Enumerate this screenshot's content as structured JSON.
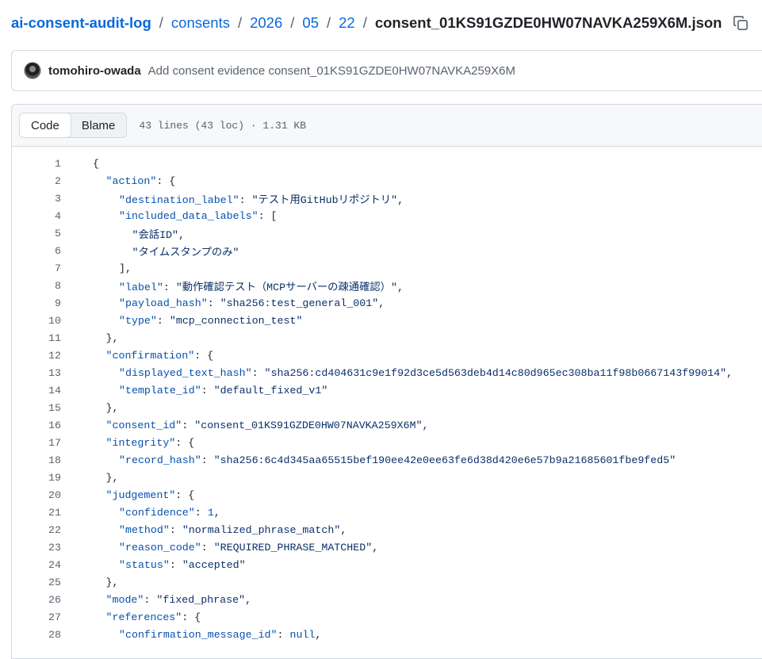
{
  "breadcrumb": {
    "repo": "ai-consent-audit-log",
    "parts": [
      "consents",
      "2026",
      "05",
      "22"
    ],
    "file": "consent_01KS91GZDE0HW07NAVKA259X6M.json",
    "separator": "/"
  },
  "commit": {
    "author": "tomohiro-owada",
    "message": "Add consent evidence consent_01KS91GZDE0HW07NAVKA259X6M"
  },
  "file_header": {
    "tabs": [
      "Code",
      "Blame"
    ],
    "active_tab": "Code",
    "meta": "43 lines (43 loc) · 1.31 KB"
  },
  "icons": {
    "copy": "copy-icon"
  },
  "colors": {
    "link": "#0969da",
    "key": "#0550ae",
    "string": "#0a3069"
  },
  "code_lines": [
    {
      "n": "1",
      "indent": 0,
      "parts": [
        [
          "p",
          "{"
        ]
      ]
    },
    {
      "n": "2",
      "indent": 1,
      "parts": [
        [
          "k",
          "\"action\""
        ],
        [
          "p",
          ": {"
        ]
      ]
    },
    {
      "n": "3",
      "indent": 2,
      "parts": [
        [
          "k",
          "\"destination_label\""
        ],
        [
          "p",
          ": "
        ],
        [
          "s",
          "\"テスト用GitHubリポジトリ\""
        ],
        [
          "p",
          ","
        ]
      ]
    },
    {
      "n": "4",
      "indent": 2,
      "parts": [
        [
          "k",
          "\"included_data_labels\""
        ],
        [
          "p",
          ": ["
        ]
      ]
    },
    {
      "n": "5",
      "indent": 3,
      "parts": [
        [
          "s",
          "\"会話ID\""
        ],
        [
          "p",
          ","
        ]
      ]
    },
    {
      "n": "6",
      "indent": 3,
      "parts": [
        [
          "s",
          "\"タイムスタンプのみ\""
        ]
      ]
    },
    {
      "n": "7",
      "indent": 2,
      "parts": [
        [
          "p",
          "],"
        ]
      ]
    },
    {
      "n": "8",
      "indent": 2,
      "parts": [
        [
          "k",
          "\"label\""
        ],
        [
          "p",
          ": "
        ],
        [
          "s",
          "\"動作確認テスト（MCPサーバーの疎通確認）\""
        ],
        [
          "p",
          ","
        ]
      ]
    },
    {
      "n": "9",
      "indent": 2,
      "parts": [
        [
          "k",
          "\"payload_hash\""
        ],
        [
          "p",
          ": "
        ],
        [
          "s",
          "\"sha256:test_general_001\""
        ],
        [
          "p",
          ","
        ]
      ]
    },
    {
      "n": "10",
      "indent": 2,
      "parts": [
        [
          "k",
          "\"type\""
        ],
        [
          "p",
          ": "
        ],
        [
          "s",
          "\"mcp_connection_test\""
        ]
      ]
    },
    {
      "n": "11",
      "indent": 1,
      "parts": [
        [
          "p",
          "},"
        ]
      ]
    },
    {
      "n": "12",
      "indent": 1,
      "parts": [
        [
          "k",
          "\"confirmation\""
        ],
        [
          "p",
          ": {"
        ]
      ]
    },
    {
      "n": "13",
      "indent": 2,
      "parts": [
        [
          "k",
          "\"displayed_text_hash\""
        ],
        [
          "p",
          ": "
        ],
        [
          "s",
          "\"sha256:cd404631c9e1f92d3ce5d563deb4d14c80d965ec308ba11f98b0667143f99014\""
        ],
        [
          "p",
          ","
        ]
      ]
    },
    {
      "n": "14",
      "indent": 2,
      "parts": [
        [
          "k",
          "\"template_id\""
        ],
        [
          "p",
          ": "
        ],
        [
          "s",
          "\"default_fixed_v1\""
        ]
      ]
    },
    {
      "n": "15",
      "indent": 1,
      "parts": [
        [
          "p",
          "},"
        ]
      ]
    },
    {
      "n": "16",
      "indent": 1,
      "parts": [
        [
          "k",
          "\"consent_id\""
        ],
        [
          "p",
          ": "
        ],
        [
          "s",
          "\"consent_01KS91GZDE0HW07NAVKA259X6M\""
        ],
        [
          "p",
          ","
        ]
      ]
    },
    {
      "n": "17",
      "indent": 1,
      "parts": [
        [
          "k",
          "\"integrity\""
        ],
        [
          "p",
          ": {"
        ]
      ]
    },
    {
      "n": "18",
      "indent": 2,
      "parts": [
        [
          "k",
          "\"record_hash\""
        ],
        [
          "p",
          ": "
        ],
        [
          "s",
          "\"sha256:6c4d345aa65515bef190ee42e0ee63fe6d38d420e6e57b9a21685601fbe9fed5\""
        ]
      ]
    },
    {
      "n": "19",
      "indent": 1,
      "parts": [
        [
          "p",
          "},"
        ]
      ]
    },
    {
      "n": "20",
      "indent": 1,
      "parts": [
        [
          "k",
          "\"judgement\""
        ],
        [
          "p",
          ": {"
        ]
      ]
    },
    {
      "n": "21",
      "indent": 2,
      "parts": [
        [
          "k",
          "\"confidence\""
        ],
        [
          "p",
          ": "
        ],
        [
          "n",
          "1"
        ],
        [
          "p",
          ","
        ]
      ]
    },
    {
      "n": "22",
      "indent": 2,
      "parts": [
        [
          "k",
          "\"method\""
        ],
        [
          "p",
          ": "
        ],
        [
          "s",
          "\"normalized_phrase_match\""
        ],
        [
          "p",
          ","
        ]
      ]
    },
    {
      "n": "23",
      "indent": 2,
      "parts": [
        [
          "k",
          "\"reason_code\""
        ],
        [
          "p",
          ": "
        ],
        [
          "s",
          "\"REQUIRED_PHRASE_MATCHED\""
        ],
        [
          "p",
          ","
        ]
      ]
    },
    {
      "n": "24",
      "indent": 2,
      "parts": [
        [
          "k",
          "\"status\""
        ],
        [
          "p",
          ": "
        ],
        [
          "s",
          "\"accepted\""
        ]
      ]
    },
    {
      "n": "25",
      "indent": 1,
      "parts": [
        [
          "p",
          "},"
        ]
      ]
    },
    {
      "n": "26",
      "indent": 1,
      "parts": [
        [
          "k",
          "\"mode\""
        ],
        [
          "p",
          ": "
        ],
        [
          "s",
          "\"fixed_phrase\""
        ],
        [
          "p",
          ","
        ]
      ]
    },
    {
      "n": "27",
      "indent": 1,
      "parts": [
        [
          "k",
          "\"references\""
        ],
        [
          "p",
          ": {"
        ]
      ]
    },
    {
      "n": "28",
      "indent": 2,
      "parts": [
        [
          "k",
          "\"confirmation_message_id\""
        ],
        [
          "p",
          ": "
        ],
        [
          "n",
          "null"
        ],
        [
          "p",
          ","
        ]
      ]
    }
  ]
}
